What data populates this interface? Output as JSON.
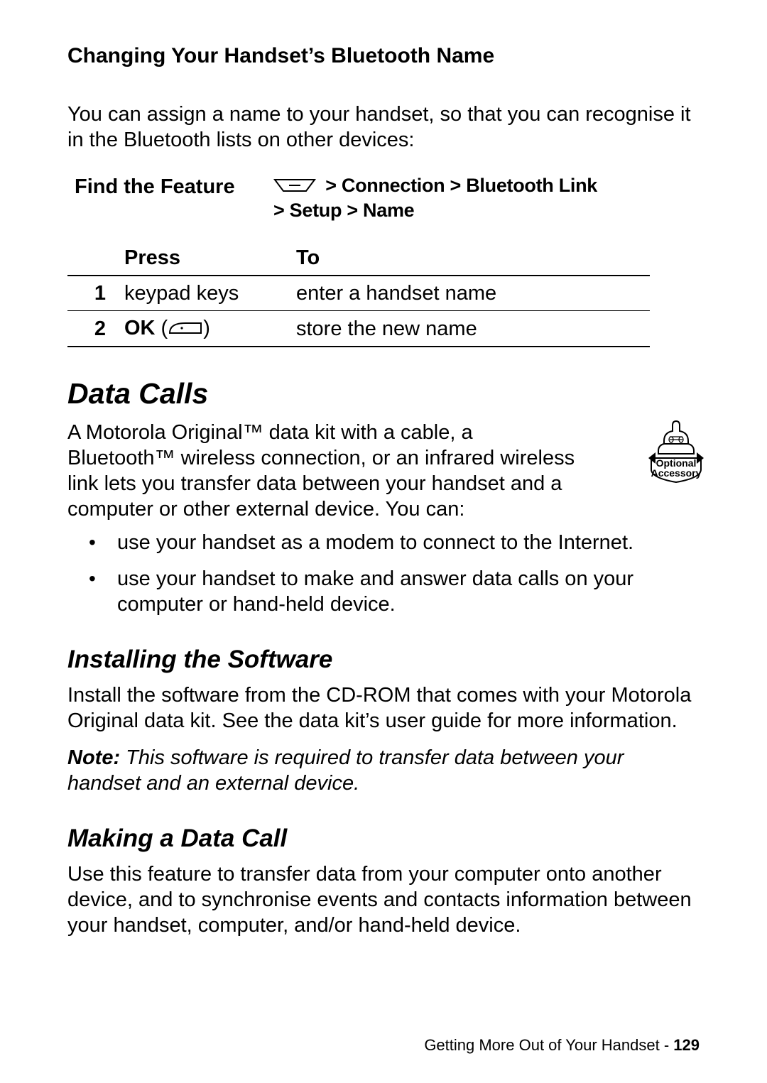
{
  "section1": {
    "title": "Changing Your Handset’s Bluetooth Name",
    "intro": "You can assign a name to your handset, so that you can recognise it in the Bluetooth lists on other devices:",
    "find_label": "Find the Feature",
    "menu_path_1": " > Connection > Bluetooth Link",
    "menu_path_2": "> Setup > Name",
    "table": {
      "head_press": "Press",
      "head_to": "To",
      "rows": [
        {
          "idx": "1",
          "press": "keypad keys",
          "to": "enter a handset name"
        },
        {
          "idx": "2",
          "press_prefix": "OK",
          "to": "store the new name"
        }
      ]
    }
  },
  "section2": {
    "title": "Data Calls",
    "para": "A Motorola Original™ data kit with a cable, a Bluetooth™ wireless connection, or an infrared wireless link lets you transfer data between your handset and a computer or other external device. You can:",
    "badge_top": "Optional",
    "badge_bottom": "Accessory",
    "bullets": [
      "use your handset as a modem to connect to the Internet.",
      "use your handset to make and answer data calls on your computer or hand-held device."
    ]
  },
  "section3": {
    "title": "Installing the Software",
    "para": "Install the software from the CD-ROM that comes with your Motorola Original data kit. See the data kit’s user guide for more information.",
    "note_label": "Note: ",
    "note_text": "This software is required to transfer data between your handset and an external device."
  },
  "section4": {
    "title": "Making a Data Call",
    "para": "Use this feature to transfer data from your computer onto another device, and to synchronise events and contacts information between your handset, computer, and/or hand-held device."
  },
  "footer": {
    "section": "Getting More Out of Your Handset - ",
    "page": "129"
  }
}
